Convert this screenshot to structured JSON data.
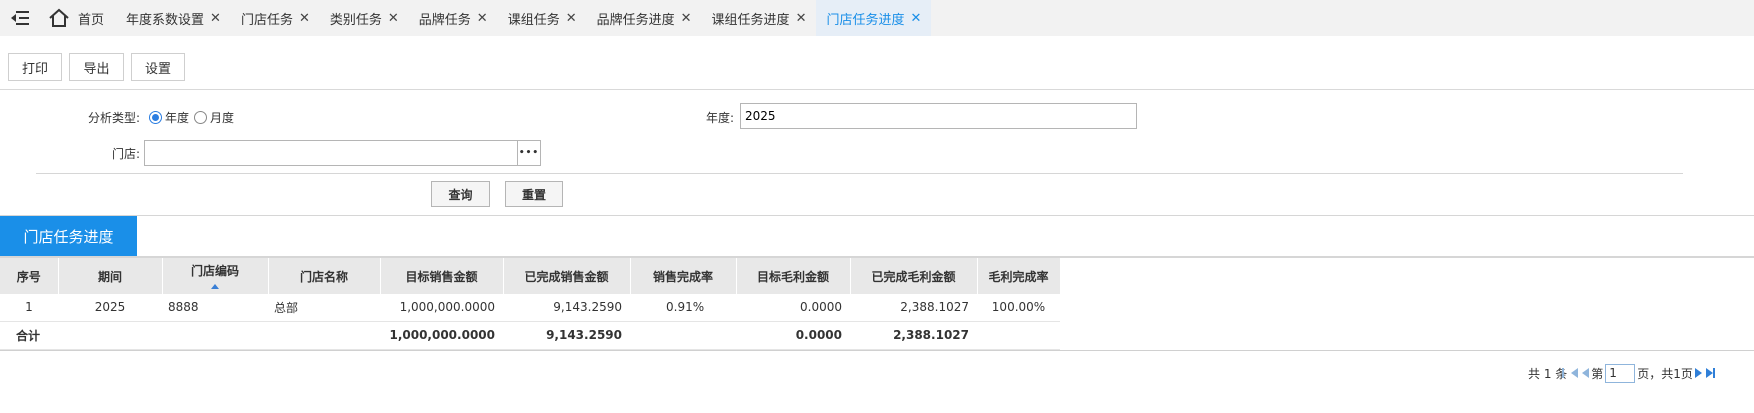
{
  "tabs": {
    "home_label": "首页",
    "items": [
      {
        "label": "年度系数设置"
      },
      {
        "label": "门店任务"
      },
      {
        "label": "类别任务"
      },
      {
        "label": "品牌任务"
      },
      {
        "label": "课组任务"
      },
      {
        "label": "品牌任务进度"
      },
      {
        "label": "课组任务进度"
      },
      {
        "label": "门店任务进度",
        "active": true
      }
    ],
    "close_glyph": "✕"
  },
  "toolbar": {
    "print_label": "打印",
    "export_label": "导出",
    "settings_label": "设置"
  },
  "form": {
    "analysis_type_label": "分析类型:",
    "analysis_options": [
      "年度",
      "月度"
    ],
    "analysis_selected": "年度",
    "year_label": "年度:",
    "year_value": "2025",
    "store_label": "门店:",
    "store_value": "",
    "browse_label": "•••",
    "query_label": "查询",
    "reset_label": "重置"
  },
  "section": {
    "title": "门店任务进度"
  },
  "table": {
    "columns": [
      "序号",
      "期间",
      "门店编码",
      "门店名称",
      "目标销售金额",
      "已完成销售金额",
      "销售完成率",
      "目标毛利金额",
      "已完成毛利金额",
      "毛利完成率"
    ],
    "rows": [
      [
        "1",
        "2025",
        "8888",
        "总部",
        "1,000,000.0000",
        "9,143.2590",
        "0.91%",
        "0.0000",
        "2,388.1027",
        "100.00%"
      ]
    ],
    "total": {
      "label": "合计",
      "target_sales": "1,000,000.0000",
      "completed_sales": "9,143.2590",
      "target_profit": "0.0000",
      "completed_profit": "2,388.1027"
    }
  },
  "pager": {
    "total_text": "共 1 条",
    "page_prefix": "第",
    "current_page": "1",
    "page_suffix": "页，共1页"
  },
  "colors": {
    "accent": "#1a8fe8",
    "header_bg": "#e8e8e8"
  }
}
